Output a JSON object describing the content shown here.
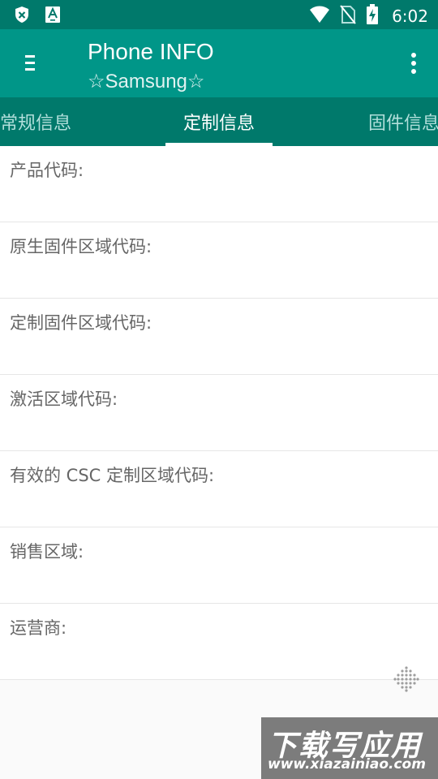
{
  "status_bar": {
    "time": "6:02",
    "icons_left": [
      "shield-icon",
      "font-icon"
    ],
    "icons_right": [
      "wifi-icon",
      "no-sim-icon",
      "battery-charging-icon"
    ]
  },
  "app_bar": {
    "title": "Phone INFO",
    "subtitle": "☆Samsung☆",
    "menu_icon": "menu-icon",
    "more_icon": "more-vert-icon"
  },
  "tabs": [
    {
      "label": "常规信息",
      "active": false
    },
    {
      "label": "定制信息",
      "active": true
    },
    {
      "label": "固件信息",
      "active": false
    }
  ],
  "rows": [
    {
      "label": "产品代码:"
    },
    {
      "label": "原生固件区域代码:"
    },
    {
      "label": "定制固件区域代码:"
    },
    {
      "label": "激活区域代码:"
    },
    {
      "label": "有效的 CSC 定制区域代码:"
    },
    {
      "label": "销售区域:"
    },
    {
      "label": "运营商:"
    }
  ],
  "watermark": {
    "title": "下载写应用",
    "url": "www.xiazainiao.com"
  },
  "colors": {
    "status_bar": "#00796b",
    "app_bar": "#009688",
    "tab_bar": "#00796b",
    "row_text": "#666666"
  }
}
